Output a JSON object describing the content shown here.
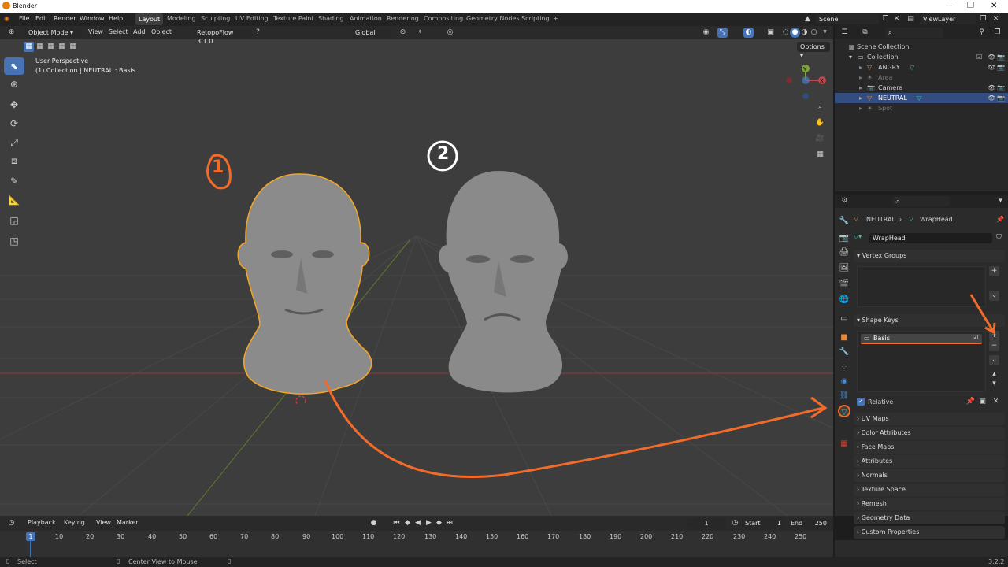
{
  "title_bar": {
    "title": "Blender"
  },
  "menu": {
    "file": "File",
    "edit": "Edit",
    "render": "Render",
    "window": "Window",
    "help": "Help"
  },
  "workspaces": [
    "Layout",
    "Modeling",
    "Sculpting",
    "UV Editing",
    "Texture Paint",
    "Shading",
    "Animation",
    "Rendering",
    "Compositing",
    "Geometry Nodes",
    "Scripting"
  ],
  "scene": {
    "name": "Scene",
    "view_layer": "ViewLayer"
  },
  "viewport": {
    "mode": "Object Mode",
    "menus": {
      "view": "View",
      "select": "Select",
      "add": "Add",
      "object": "Object"
    },
    "addon": "RetopoFlow 3.1.0",
    "transform_orientation": "Global",
    "options": "Options",
    "perspective": "User Perspective",
    "context": "(1) Collection | NEUTRAL : Basis",
    "annotations": {
      "one": "1",
      "two": "2"
    },
    "gizmo": {
      "x": "X",
      "y": "Y",
      "z": "Z"
    }
  },
  "outliner": {
    "root": "Scene Collection",
    "collection": "Collection",
    "items": [
      {
        "label": "ANGRY",
        "dim": false
      },
      {
        "label": "Area",
        "dim": true
      },
      {
        "label": "Camera",
        "dim": false
      },
      {
        "label": "NEUTRAL",
        "dim": false,
        "selected": true
      },
      {
        "label": "Spot",
        "dim": true
      }
    ]
  },
  "properties": {
    "breadcrumb": {
      "object": "NEUTRAL",
      "data": "WrapHead"
    },
    "mesh_name": "WrapHead",
    "panels": {
      "vertex_groups": "Vertex Groups",
      "shape_keys": "Shape Keys",
      "relative": "Relative",
      "uv_maps": "UV Maps",
      "color_attributes": "Color Attributes",
      "face_maps": "Face Maps",
      "attributes": "Attributes",
      "normals": "Normals",
      "texture_space": "Texture Space",
      "remesh": "Remesh",
      "geometry_data": "Geometry Data",
      "custom_properties": "Custom Properties"
    },
    "shape_key_item": "Basis"
  },
  "timeline": {
    "menus": {
      "playback": "Playback",
      "keying": "Keying",
      "view": "View",
      "marker": "Marker"
    },
    "current_frame": "1",
    "start_label": "Start",
    "start": "1",
    "end_label": "End",
    "end": "250",
    "ticks": [
      "10",
      "20",
      "30",
      "40",
      "50",
      "60",
      "70",
      "80",
      "90",
      "100",
      "110",
      "120",
      "130",
      "140",
      "150",
      "160",
      "170",
      "180",
      "190",
      "200",
      "210",
      "220",
      "230",
      "240",
      "250"
    ],
    "playhead": "1"
  },
  "status": {
    "select": "Select",
    "center": "Center View to Mouse",
    "version": "3.2.2"
  },
  "colors": {
    "accent": "#4772b3",
    "annotation": "#f26b2a",
    "selection_outline": "#f5a623"
  }
}
